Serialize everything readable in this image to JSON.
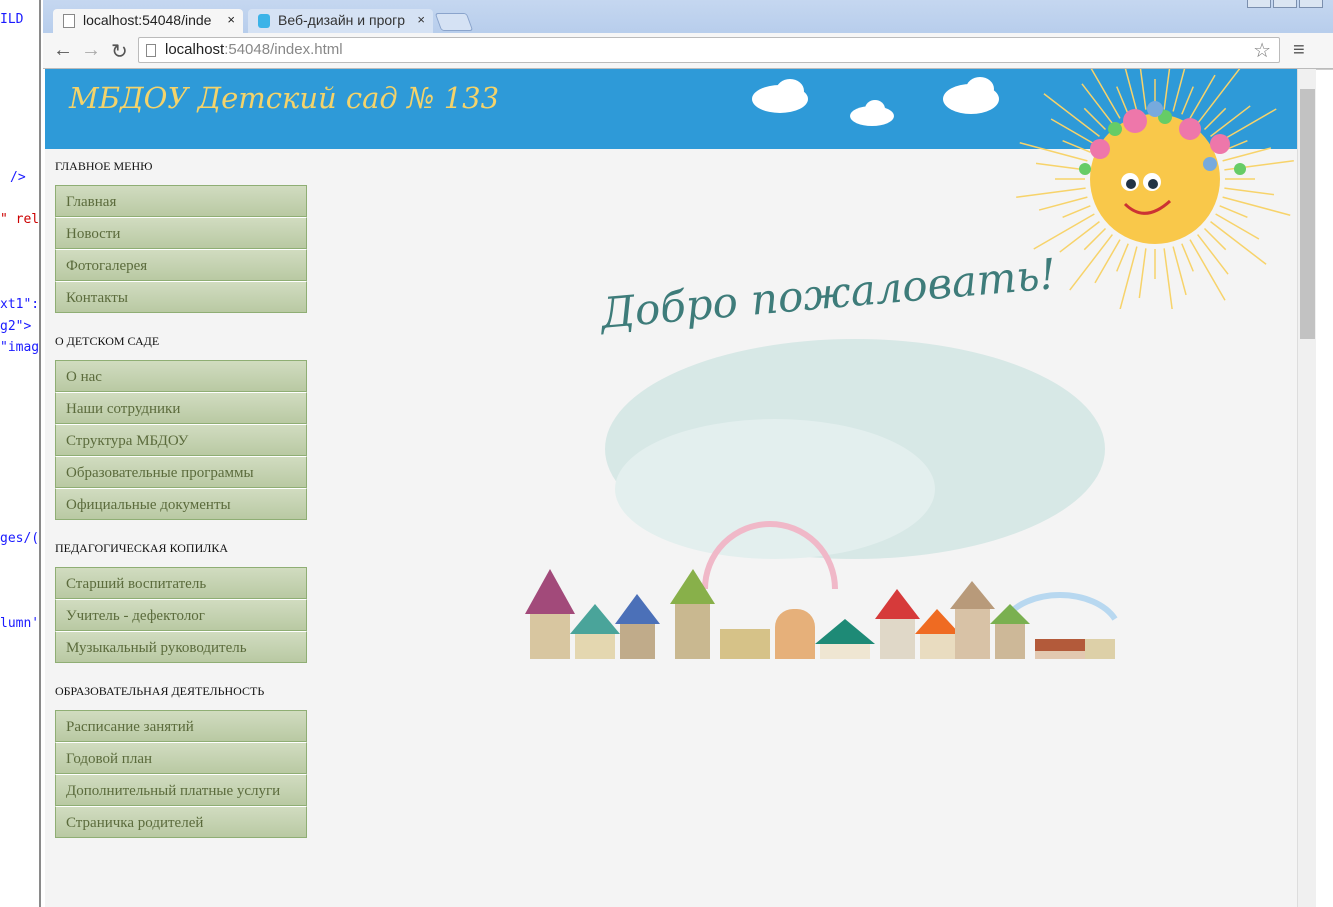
{
  "editor_fragments": [
    "ILD",
    "/>",
    "\" rel",
    "xt1\":",
    "g2\">",
    "\"imag",
    "ges/(",
    "lumn'"
  ],
  "browser": {
    "tabs": [
      {
        "label": "localhost:54048/inde"
      },
      {
        "label": "Веб-дизайн и прогр"
      }
    ],
    "close_glyph": "×",
    "url_host": "localhost",
    "url_rest": ":54048/index.html",
    "back": "←",
    "forward": "→",
    "reload": "↻",
    "star": "☆",
    "menu": "≡"
  },
  "header": {
    "title": "МБДОУ Детский сад № 133",
    "bg": "#2e9ad8"
  },
  "sidebar": {
    "sections": [
      {
        "title": "ГЛАВНОЕ МЕНЮ",
        "items": [
          "Главная",
          "Новости",
          "Фотогалерея",
          "Контакты"
        ]
      },
      {
        "title": "О ДЕТСКОМ САДЕ",
        "items": [
          "О нас",
          "Наши сотрудники",
          "Структура МБДОУ",
          "Образовательные программы",
          "Официальные документы"
        ]
      },
      {
        "title": "ПЕДАГОГИЧЕСКАЯ КОПИЛКА",
        "items": [
          "Старший воспитатель",
          "Учитель - дефектолог",
          "Музыкальный руководитель"
        ]
      },
      {
        "title": "ОБРАЗОВАТЕЛЬНАЯ ДЕЯТЕЛЬНОСТЬ",
        "items": [
          "Расписание занятий",
          "Годовой план",
          "Дополнительный платные услуги",
          "Страничка родителей"
        ]
      }
    ]
  },
  "main": {
    "welcome": "Добро пожаловать!"
  }
}
